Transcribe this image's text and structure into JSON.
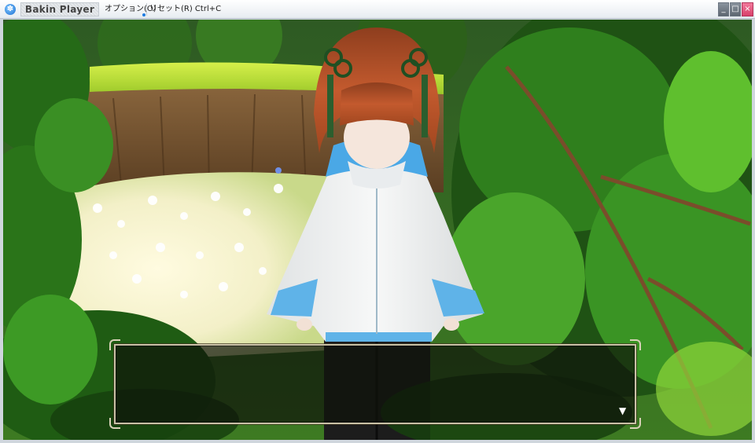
{
  "window": {
    "title": "Bakin Player",
    "menu": {
      "options_label": "オプション(O)",
      "reset_label": "リセット(R) Ctrl+C"
    },
    "controls": {
      "minimize_glyph": "_",
      "maximize_glyph": "□",
      "close_glyph": "×"
    }
  },
  "game": {
    "message": {
      "text": "",
      "next_indicator": "▼"
    }
  },
  "colors": {
    "foliage_dark": "#1f4a14",
    "foliage_light": "#5fbf2e",
    "grass": "#b6df3a",
    "cliff": "#7a5a38",
    "hoodie": "#f1f2f2",
    "hood_accent": "#4aa8e6",
    "hair": "#b5502a",
    "message_frame": "#c9c1a6"
  }
}
